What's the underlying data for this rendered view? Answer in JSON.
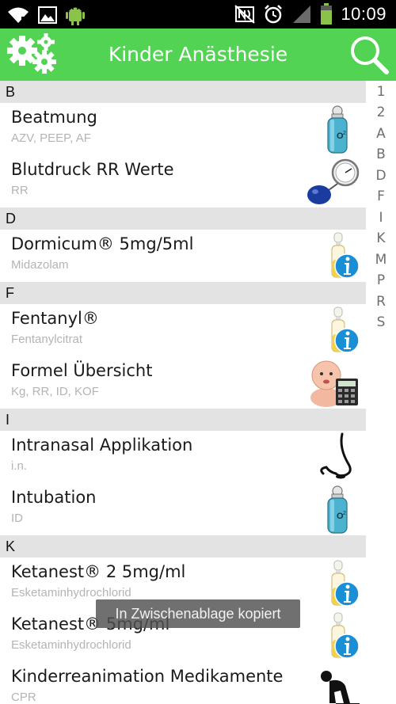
{
  "status_bar": {
    "time": "10:09",
    "icons": [
      "wifi-icon",
      "image-icon",
      "android-icon",
      "nfc-icon",
      "alarm-icon",
      "signal-icon",
      "battery-icon"
    ]
  },
  "app_bar": {
    "title": "Kinder Anästhesie",
    "settings_icon": "gears-icon",
    "search_icon": "search-icon"
  },
  "colors": {
    "app_bar": "#52d353",
    "section_header": "#e3e3e3",
    "subtitle": "#b4b4b4",
    "oxygen_cyan": "#47a7c2",
    "info_blue": "#1b8fd6",
    "pump_blue": "#1b3c9f"
  },
  "list": {
    "sections": [
      {
        "letter": "B",
        "items": [
          {
            "title": "Beatmung",
            "subtitle": "AZV, PEEP, AF",
            "icon": "oxygen-tank-icon"
          },
          {
            "title": "Blutdruck RR Werte",
            "subtitle": "RR",
            "icon": "blood-pressure-cuff-icon"
          }
        ]
      },
      {
        "letter": "D",
        "items": [
          {
            "title": "Dormicum® 5mg/5ml",
            "subtitle": "Midazolam",
            "icon": "ampoule-info-icon"
          }
        ]
      },
      {
        "letter": "F",
        "items": [
          {
            "title": "Fentanyl®",
            "subtitle": "Fentanylcitrat",
            "icon": "ampoule-info-icon"
          },
          {
            "title": "Formel Übersicht",
            "subtitle": "Kg, RR, ID, KOF",
            "icon": "baby-calculator-icon"
          }
        ]
      },
      {
        "letter": "I",
        "items": [
          {
            "title": "Intranasal Applikation",
            "subtitle": "i.n.",
            "icon": "nose-icon"
          },
          {
            "title": "Intubation",
            "subtitle": "ID",
            "icon": "oxygen-tank-icon"
          }
        ]
      },
      {
        "letter": "K",
        "items": [
          {
            "title": "Ketanest® 2 5mg/ml",
            "subtitle": "Esketaminhydrochlorid",
            "icon": "ampoule-info-icon"
          },
          {
            "title": "Ketanest® 5mg/ml",
            "subtitle": "Esketaminhydrochlorid",
            "icon": "ampoule-info-icon"
          },
          {
            "title": "Kinderreanimation Medikamente",
            "subtitle": "CPR",
            "icon": "cpr-icon"
          }
        ]
      }
    ]
  },
  "index": [
    "1",
    "2",
    "A",
    "B",
    "D",
    "F",
    "I",
    "K",
    "M",
    "P",
    "R",
    "S"
  ],
  "toast": {
    "text": "In Zwischenablage kopiert"
  }
}
